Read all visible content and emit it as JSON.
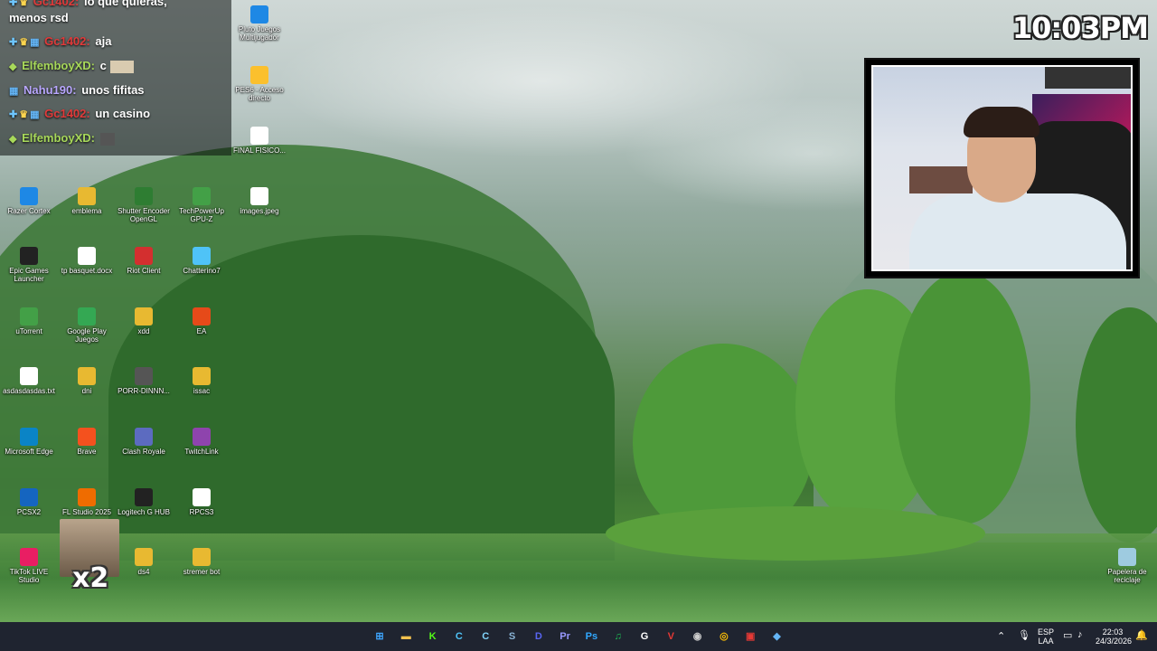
{
  "clock": "10:03PM",
  "chat": {
    "messages": [
      {
        "user": "Gc1402",
        "text": "lo que quieras,",
        "color": "#e03a3a"
      },
      {
        "user": "",
        "text": "menos rsd",
        "color": "#ffffff"
      },
      {
        "user": "Gc1402",
        "text": "aja",
        "color": "#e03a3a"
      },
      {
        "user": "ElfemboyXD",
        "text": "c",
        "color": "#a8d95a"
      },
      {
        "user": "Nahu190",
        "text": "unos fifitas",
        "color": "#b9a7ff"
      },
      {
        "user": "Gc1402",
        "text": "un casino",
        "color": "#e03a3a"
      },
      {
        "user": "ElfemboyXD",
        "text": "",
        "color": "#a8d95a"
      }
    ]
  },
  "desktop_icons": [
    {
      "label": "Razer Cortex",
      "icon": "razer-cortex-icon",
      "color": "#1e88e5"
    },
    {
      "label": "emblema",
      "icon": "folder-icon",
      "color": "#e8b931"
    },
    {
      "label": "Shutter Encoder OpenGL",
      "icon": "shutter-encoder-icon",
      "color": "#2e7d32"
    },
    {
      "label": "TechPowerUp GPU-Z",
      "icon": "gpuz-icon",
      "color": "#43a047"
    },
    {
      "label": "images.jpeg",
      "icon": "image-file-icon",
      "color": "#ffffff"
    },
    {
      "label": "Epic Games Launcher",
      "icon": "epic-games-icon",
      "color": "#222222"
    },
    {
      "label": "tp basquet.docx",
      "icon": "docx-file-icon",
      "color": "#ffffff"
    },
    {
      "label": "Riot Client",
      "icon": "riot-client-icon",
      "color": "#d32f2f"
    },
    {
      "label": "Chatterino7",
      "icon": "chatterino-icon",
      "color": "#4fc3f7"
    },
    {
      "label": "uTorrent",
      "icon": "utorrent-icon",
      "color": "#43a047"
    },
    {
      "label": "Google Play Juegos",
      "icon": "google-play-icon",
      "color": "#34a853"
    },
    {
      "label": "xdd",
      "icon": "folder-icon",
      "color": "#e8b931"
    },
    {
      "label": "EA",
      "icon": "ea-icon",
      "color": "#e64a19"
    },
    {
      "label": "asdasdasdas.txt",
      "icon": "text-file-icon",
      "color": "#ffffff"
    },
    {
      "label": "dni",
      "icon": "folder-icon",
      "color": "#e8b931"
    },
    {
      "label": "PORR-DINNN...",
      "icon": "app-icon",
      "color": "#555555"
    },
    {
      "label": "issac",
      "icon": "folder-icon",
      "color": "#e8b931"
    },
    {
      "label": "Microsoft Edge",
      "icon": "edge-icon",
      "color": "#0a84c6"
    },
    {
      "label": "Brave",
      "icon": "brave-icon",
      "color": "#f4511e"
    },
    {
      "label": "Clash Royale",
      "icon": "clash-royale-icon",
      "color": "#5c6bc0"
    },
    {
      "label": "TwitchLink",
      "icon": "twitchlink-icon",
      "color": "#8e44ad"
    },
    {
      "label": "PCSX2",
      "icon": "pcsx2-icon",
      "color": "#1565c0"
    },
    {
      "label": "FL Studio 2025",
      "icon": "fl-studio-icon",
      "color": "#ef6c00"
    },
    {
      "label": "Logitech G HUB",
      "icon": "logitech-ghub-icon",
      "color": "#222222"
    },
    {
      "label": "RPCS3",
      "icon": "rpcs3-icon",
      "color": "#ffffff"
    },
    {
      "label": "TikTok LIVE Studio",
      "icon": "tiktok-live-icon",
      "color": "#e91e63"
    },
    {
      "label": "ds4",
      "icon": "folder-icon",
      "color": "#e8b931"
    },
    {
      "label": "stremer bot",
      "icon": "folder-icon",
      "color": "#e8b931"
    },
    {
      "label": "Pluto Juegos Multijugador",
      "icon": "pluto-icon",
      "color": "#1e88e5"
    },
    {
      "label": "PES6 - Acceso directo",
      "icon": "pes6-icon",
      "color": "#fbc02d"
    },
    {
      "label": "FINAL FISICO...",
      "icon": "pdf-file-icon",
      "color": "#ffffff"
    },
    {
      "label": "Papelera de reciclaje",
      "icon": "recycle-bin-icon",
      "color": "#9ecbe0"
    }
  ],
  "emote_text": "x2",
  "taskbar": {
    "apps": [
      {
        "name": "start-icon",
        "glyph": "⊞",
        "color": "#3ea6ff"
      },
      {
        "name": "file-explorer-icon",
        "glyph": "▬",
        "color": "#f2c14e"
      },
      {
        "name": "kick-icon",
        "glyph": "K",
        "color": "#53fc18"
      },
      {
        "name": "chatterino-icon",
        "glyph": "C",
        "color": "#4fc3f7"
      },
      {
        "name": "chatterino-alt-icon",
        "glyph": "C",
        "color": "#81d4fa"
      },
      {
        "name": "steam-icon",
        "glyph": "S",
        "color": "#8ab4d6"
      },
      {
        "name": "discord-icon",
        "glyph": "D",
        "color": "#5865f2"
      },
      {
        "name": "premiere-icon",
        "glyph": "Pr",
        "color": "#9999ff"
      },
      {
        "name": "photoshop-icon",
        "glyph": "Ps",
        "color": "#31a8ff"
      },
      {
        "name": "spotify-icon",
        "glyph": "♫",
        "color": "#1db954"
      },
      {
        "name": "logitech-ghub-icon",
        "glyph": "G",
        "color": "#ffffff"
      },
      {
        "name": "riot-vanguard-icon",
        "glyph": "V",
        "color": "#e53935"
      },
      {
        "name": "obs-icon",
        "glyph": "◉",
        "color": "#cccccc"
      },
      {
        "name": "chrome-icon",
        "glyph": "◎",
        "color": "#fbbc05"
      },
      {
        "name": "stream-app-icon",
        "glyph": "▣",
        "color": "#e53935"
      },
      {
        "name": "app-diamond-icon",
        "glyph": "◆",
        "color": "#64b5f6"
      }
    ],
    "lang_top": "ESP",
    "lang_bottom": "LAA",
    "time": "22:03",
    "date": "24/3/2026"
  }
}
